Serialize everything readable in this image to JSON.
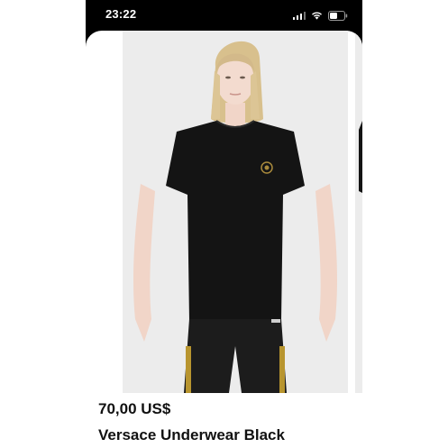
{
  "status_bar": {
    "time": "23:22"
  },
  "product": {
    "price": "70,00 US$",
    "name": "Versace Underwear Black"
  },
  "icons": [
    "signal-icon",
    "wifi-icon",
    "battery-icon"
  ],
  "colors": {
    "status_bar_bg": "#000000",
    "image_bg": "#ececec",
    "text": "#111111"
  }
}
